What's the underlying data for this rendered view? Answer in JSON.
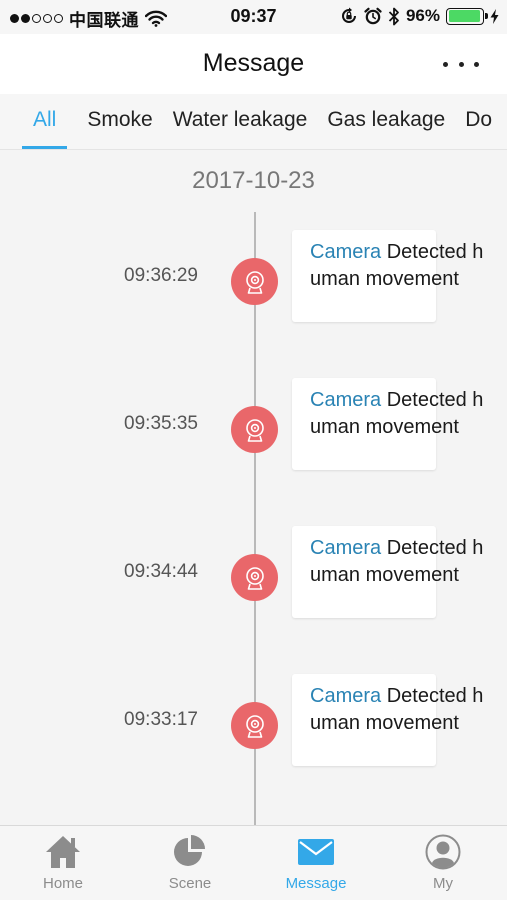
{
  "status_bar": {
    "carrier": "中国联通",
    "time": "09:37",
    "battery": "96%",
    "battery_level": 0.96
  },
  "header": {
    "title": "Message"
  },
  "tabs": [
    {
      "label": "All"
    },
    {
      "label": "Smoke"
    },
    {
      "label": "Water leakage"
    },
    {
      "label": "Gas leakage"
    },
    {
      "label": "Do"
    }
  ],
  "timeline": {
    "date": "2017-10-23",
    "entries": [
      {
        "time": "09:36:29",
        "source": "Camera",
        "message": " Detected human movement"
      },
      {
        "time": "09:35:35",
        "source": "Camera",
        "message": " Detected human movement"
      },
      {
        "time": "09:34:44",
        "source": "Camera",
        "message": " Detected human movement"
      },
      {
        "time": "09:33:17",
        "source": "Camera",
        "message": " Detected human movement"
      }
    ]
  },
  "tab_bar": {
    "items": [
      {
        "label": "Home",
        "icon": "home-icon"
      },
      {
        "label": "Scene",
        "icon": "pie-chart-icon"
      },
      {
        "label": "Message",
        "icon": "envelope-icon"
      },
      {
        "label": "My",
        "icon": "user-icon"
      }
    ]
  },
  "colors": {
    "accent": "#33a8e8",
    "alert": "#e9676a",
    "source_text": "#2a83b4",
    "battery": "#4cd964"
  }
}
